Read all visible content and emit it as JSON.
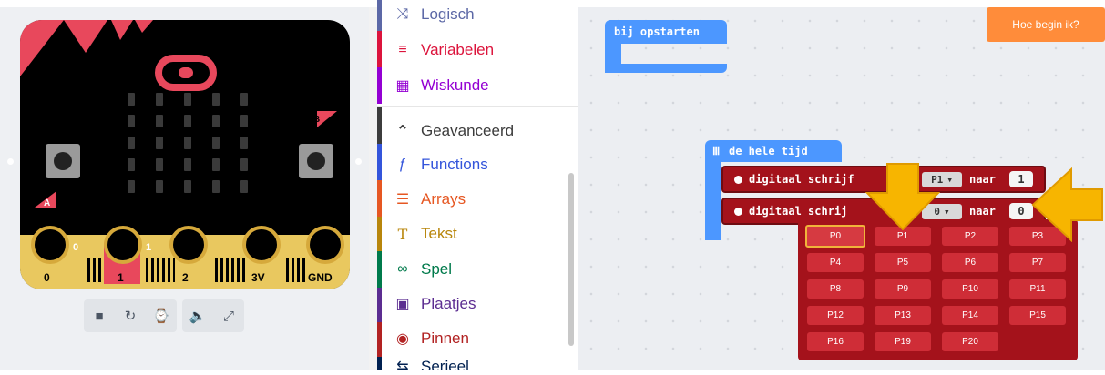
{
  "simulator": {
    "buttons": {
      "a": "A",
      "b": "B"
    },
    "pins": [
      "0",
      "1",
      "2",
      "3V",
      "GND"
    ],
    "pin_small_labels": [
      "0",
      "1"
    ],
    "toolbar": [
      {
        "icon": "stop-icon",
        "glyph": "■"
      },
      {
        "icon": "restart-icon",
        "glyph": "↻"
      },
      {
        "icon": "slowmo-icon",
        "glyph": "⌚"
      },
      {
        "icon": "mute-icon",
        "glyph": "🔈"
      },
      {
        "icon": "fullscreen-icon",
        "glyph": "⤢"
      }
    ]
  },
  "toolbox": {
    "items": [
      {
        "label": "Logisch",
        "icon": "logic-icon",
        "glyph": "⤨",
        "color": "#5c68a6"
      },
      {
        "label": "Variabelen",
        "icon": "variables-icon",
        "glyph": "≡",
        "color": "#dc143c"
      },
      {
        "label": "Wiskunde",
        "icon": "math-icon",
        "glyph": "▦",
        "color": "#9400d3"
      },
      {
        "label": "Geavanceerd",
        "icon": "chevron-up-icon",
        "glyph": "⌃",
        "color": "#3c3c3c"
      },
      {
        "label": "Functions",
        "icon": "functions-icon",
        "glyph": "ƒ",
        "color": "#3455db"
      },
      {
        "label": "Arrays",
        "icon": "arrays-icon",
        "glyph": "☰",
        "color": "#e65722"
      },
      {
        "label": "Tekst",
        "icon": "text-icon",
        "glyph": "T",
        "color": "#b8860b"
      },
      {
        "label": "Spel",
        "icon": "game-icon",
        "glyph": "∞",
        "color": "#007a4b"
      },
      {
        "label": "Plaatjes",
        "icon": "images-icon",
        "glyph": "▣",
        "color": "#5c2d91"
      },
      {
        "label": "Pinnen",
        "icon": "pins-icon",
        "glyph": "◉",
        "color": "#b22222"
      },
      {
        "label": "Serieel",
        "icon": "serial-icon",
        "glyph": "⇆",
        "color": "#002050"
      }
    ]
  },
  "workspace": {
    "help_button": "Hoe begin ik?",
    "on_start": "bij opstarten",
    "forever": "de hele tijd",
    "forever_glyph": "Ⅲ",
    "write_blocks": [
      {
        "label": "digitaal schrijf",
        "pin": "P1",
        "to": "naar",
        "value": "1"
      },
      {
        "label": "digitaal schrij",
        "pin": "0",
        "to": "naar",
        "value": "0"
      }
    ],
    "pin_options": [
      "P0",
      "P1",
      "P2",
      "P3",
      "P4",
      "P5",
      "P6",
      "P7",
      "P8",
      "P9",
      "P10",
      "P11",
      "P12",
      "P13",
      "P14",
      "P15",
      "P16",
      "P19",
      "P20"
    ],
    "selected_pin": "P0"
  },
  "colors": {
    "accent_orange": "#ff8c3a",
    "block_blue": "#4c97ff",
    "pins_red": "#a4121b",
    "microbit_red": "#e8485c"
  }
}
